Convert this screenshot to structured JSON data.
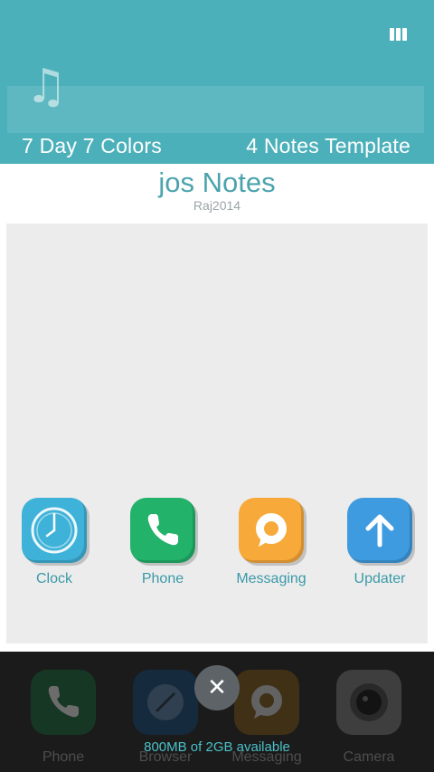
{
  "header": {
    "left_label": "7 Day 7 Colors",
    "right_label": "4 Notes Template",
    "music_icon": "music-note-icon",
    "menu_icon": "grid-menu-icon"
  },
  "title": "jos Notes",
  "subtitle": "Raj2014",
  "apps": [
    {
      "label": "Clock",
      "icon": "clock-icon",
      "color": "#3eb2d8"
    },
    {
      "label": "Phone",
      "icon": "phone-icon",
      "color": "#22b26a"
    },
    {
      "label": "Messaging",
      "icon": "message-icon",
      "color": "#f7a93a"
    },
    {
      "label": "Updater",
      "icon": "arrow-up-icon",
      "color": "#3f9bdf"
    }
  ],
  "dock": [
    {
      "label": "Phone",
      "icon": "phone-icon"
    },
    {
      "label": "Browser",
      "icon": "browser-icon"
    },
    {
      "label": "Messaging",
      "icon": "message-icon"
    },
    {
      "label": "Camera",
      "icon": "camera-icon"
    }
  ],
  "recents": {
    "close_icon": "close-icon",
    "memory_text": "800MB of 2GB available"
  }
}
